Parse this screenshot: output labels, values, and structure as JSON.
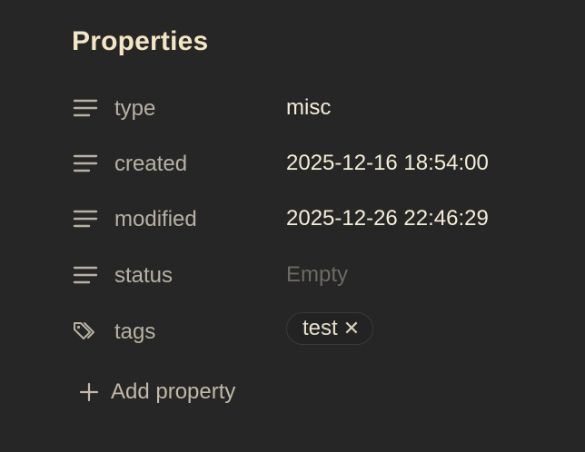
{
  "panel": {
    "title": "Properties"
  },
  "properties": [
    {
      "key": "type",
      "value": "misc",
      "icon": "text-lines-icon"
    },
    {
      "key": "created",
      "value": "2025-12-16 18:54:00",
      "icon": "text-lines-icon"
    },
    {
      "key": "modified",
      "value": "2025-12-26 22:46:29",
      "icon": "text-lines-icon"
    },
    {
      "key": "status",
      "value": "Empty",
      "icon": "text-lines-icon"
    },
    {
      "key": "tags",
      "icon": "tags-icon",
      "tags": [
        "test"
      ]
    }
  ],
  "actions": {
    "add_property_label": "Add property",
    "remove_tag_glyph": "✕"
  },
  "colors": {
    "background": "#262626",
    "title": "#f3e6c4",
    "key": "#b8b1a3",
    "value": "#f4ecd6",
    "placeholder": "#6e6a63"
  }
}
